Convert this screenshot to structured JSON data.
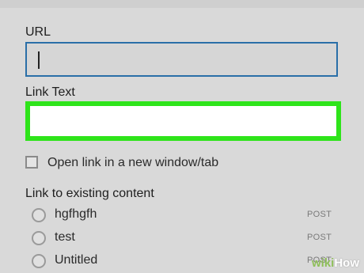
{
  "form": {
    "url_label": "URL",
    "url_value": "",
    "link_text_label": "Link Text",
    "link_text_value": "",
    "open_new_tab_label": "Open link in a new window/tab",
    "open_new_tab_checked": false
  },
  "existing_content": {
    "title": "Link to existing content",
    "items": [
      {
        "title": "hgfhgfh",
        "type": "POST"
      },
      {
        "title": "test",
        "type": "POST"
      },
      {
        "title": "Untitled",
        "type": "POST"
      }
    ]
  },
  "watermark": {
    "part1": "wiki",
    "part2": "How"
  },
  "colors": {
    "url_border": "#2a6fa8",
    "link_text_highlight": "#2ee41a",
    "background": "#d9d9d9"
  }
}
